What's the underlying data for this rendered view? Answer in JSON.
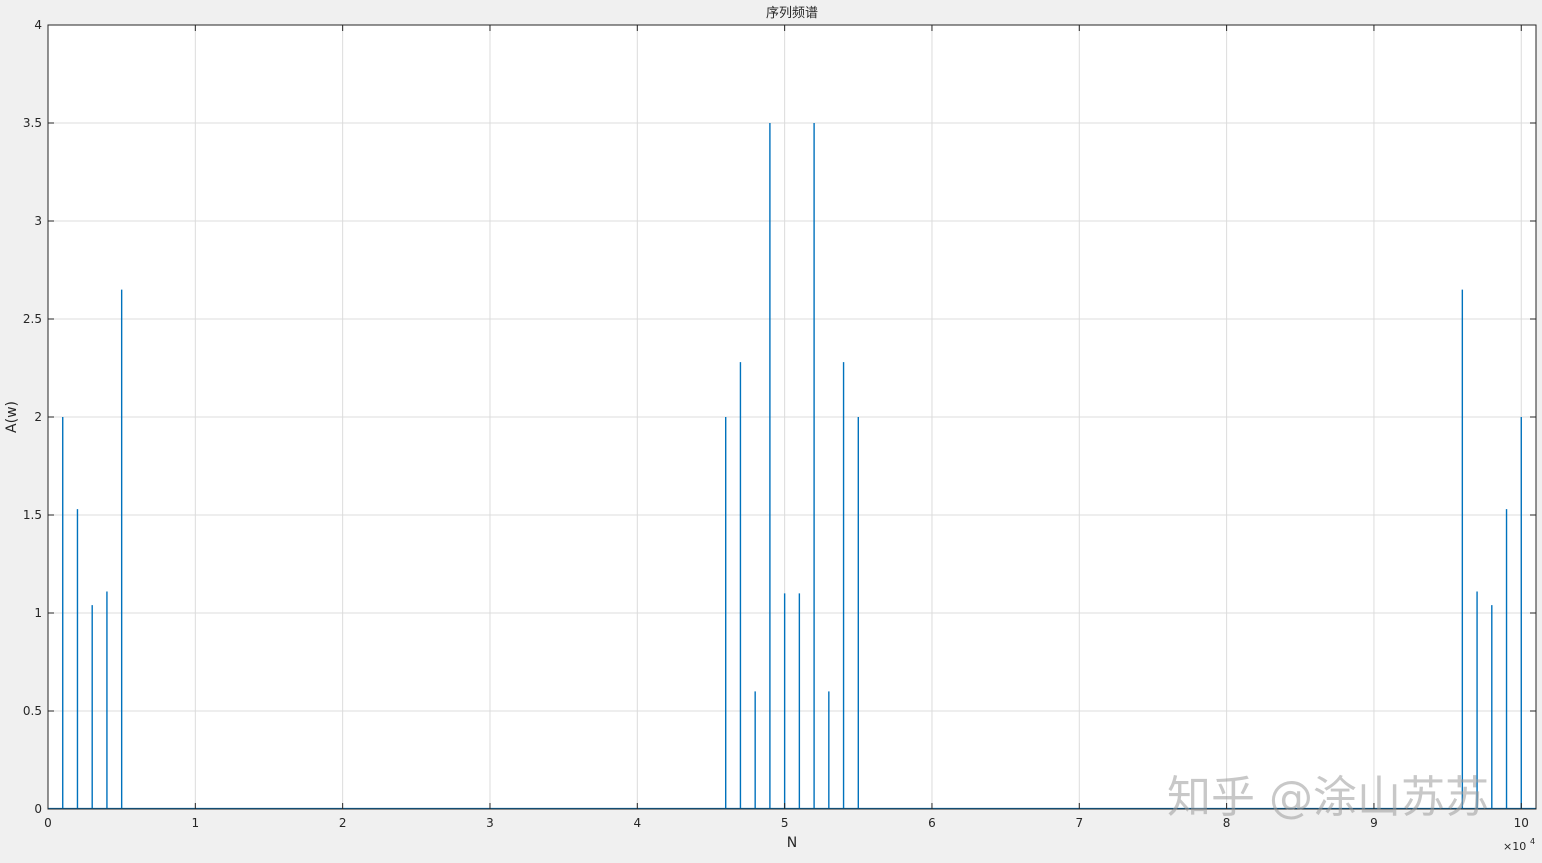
{
  "watermark": "知乎 @涂山苏苏",
  "chart_data": {
    "type": "line",
    "title": "序列频谱",
    "xlabel": "N",
    "ylabel": "A(w)",
    "x_exponent_label": "×10",
    "x_exponent_power": "4",
    "xlim": [
      0,
      101000
    ],
    "ylim": [
      0,
      4
    ],
    "grid": true,
    "legend": "none",
    "color": "#0072bd",
    "xticks": [
      0,
      10000,
      20000,
      30000,
      40000,
      50000,
      60000,
      70000,
      80000,
      90000,
      100000
    ],
    "xtick_labels": [
      "0",
      "1",
      "2",
      "3",
      "4",
      "5",
      "6",
      "7",
      "8",
      "9",
      "10"
    ],
    "yticks": [
      0,
      0.5,
      1,
      1.5,
      2,
      2.5,
      3,
      3.5,
      4
    ],
    "ytick_labels": [
      "0",
      "0.5",
      "1",
      "1.5",
      "2",
      "2.5",
      "3",
      "3.5",
      "4"
    ],
    "series": [
      {
        "x": [
          1000,
          2000,
          3000,
          4000,
          5000,
          46000,
          47000,
          48000,
          49000,
          50000,
          51000,
          52000,
          53000,
          54000,
          55000,
          96000,
          97000,
          98000,
          99000,
          100000
        ],
        "values": [
          2.0,
          1.53,
          1.04,
          1.11,
          2.65,
          2.0,
          2.28,
          0.6,
          3.5,
          1.1,
          1.1,
          3.5,
          0.6,
          2.28,
          2.0,
          2.65,
          1.11,
          1.04,
          1.53,
          2.0
        ]
      }
    ]
  }
}
